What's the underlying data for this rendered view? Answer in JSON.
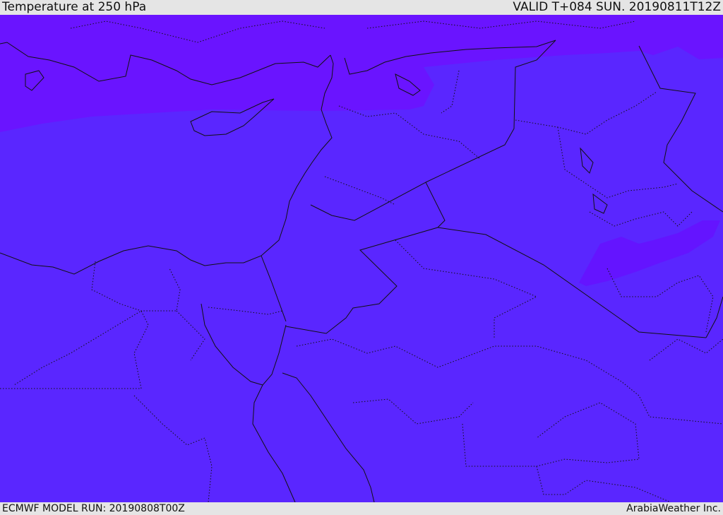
{
  "header": {
    "title": "Temperature at 250 hPa",
    "valid": "VALID T+084 SUN. 20190811T12Z"
  },
  "footer": {
    "model_run": "ECMWF MODEL RUN: 20190808T00Z",
    "credit": "ArabiaWeather Inc."
  },
  "colors": {
    "base_fill": "#5a26ff",
    "cold_fill": "#6a14ff",
    "lines": "#111111",
    "background": "#e5e5e5"
  }
}
